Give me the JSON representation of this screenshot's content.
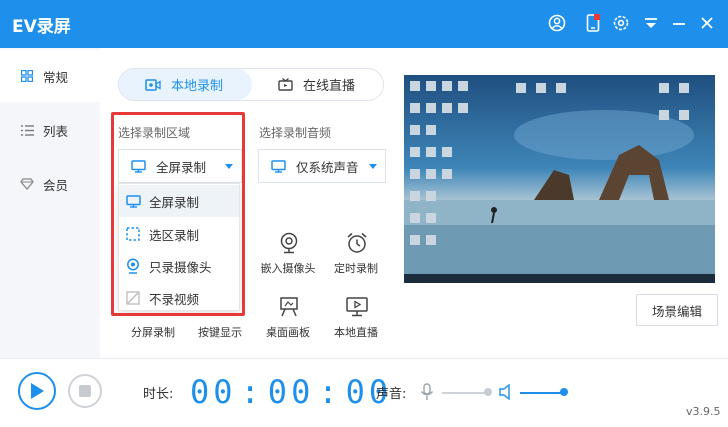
{
  "app": {
    "title": "EV录屏",
    "version": "v3.9.5"
  },
  "titlebar_icons": [
    "user-icon",
    "phone-icon",
    "settings-icon",
    "menu-icon",
    "minimize-icon",
    "close-icon"
  ],
  "sidebar": {
    "items": [
      {
        "label": "常规",
        "icon": "grid-icon",
        "active": true
      },
      {
        "label": "列表",
        "icon": "list-icon",
        "active": false
      },
      {
        "label": "会员",
        "icon": "diamond-icon",
        "active": false
      }
    ]
  },
  "tabs": [
    {
      "label": "本地录制",
      "icon": "record-camera-icon",
      "active": true
    },
    {
      "label": "在线直播",
      "icon": "tv-icon",
      "active": false
    }
  ],
  "region": {
    "label": "选择录制区域",
    "selected": "全屏录制",
    "options": [
      {
        "label": "全屏录制",
        "icon": "monitor-icon"
      },
      {
        "label": "选区录制",
        "icon": "dashed-square-icon"
      },
      {
        "label": "只录摄像头",
        "icon": "webcam-icon"
      },
      {
        "label": "不录视频",
        "icon": "no-video-icon"
      }
    ]
  },
  "audio": {
    "label": "选择录制音频",
    "selected": "仅系统声音"
  },
  "tools": [
    {
      "label": "嵌入摄像头",
      "icon": "webcam-icon"
    },
    {
      "label": "定时录制",
      "icon": "alarm-clock-icon"
    },
    {
      "label": "分屏录制",
      "icon": "split-screen-icon"
    },
    {
      "label": "按键显示",
      "icon": "keyboard-icon"
    },
    {
      "label": "桌面画板",
      "icon": "easel-icon"
    },
    {
      "label": "本地直播",
      "icon": "live-monitor-icon"
    }
  ],
  "scene_edit": "场景编辑",
  "bottom": {
    "duration_label": "时长:",
    "timer": "00:00:00",
    "volume_label": "声音:",
    "mic_level": 0.95,
    "speaker_level": 0.95
  },
  "colors": {
    "accent": "#1e90ec",
    "highlight_border": "#e8393a"
  }
}
